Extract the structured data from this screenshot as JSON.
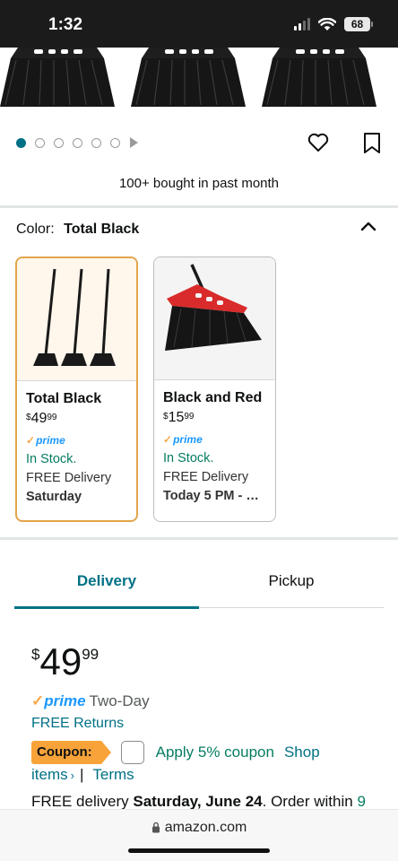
{
  "status_bar": {
    "time": "1:32",
    "battery": "68"
  },
  "carousel": {
    "dot_count": 6,
    "active_index": 0
  },
  "social_proof": "100+ bought in past month",
  "color": {
    "label": "Color:",
    "selected": "Total Black"
  },
  "swatches": [
    {
      "name": "Total Black",
      "currency": "$",
      "whole": "49",
      "cents": "99",
      "prime": "prime",
      "stock": "In Stock.",
      "delivery": "FREE Delivery",
      "day": "Saturday",
      "selected": true
    },
    {
      "name": "Black and Red",
      "currency": "$",
      "whole": "15",
      "cents": "99",
      "prime": "prime",
      "stock": "In Stock.",
      "delivery": "FREE Delivery",
      "day": "Today 5 PM - …",
      "selected": false
    }
  ],
  "tabs": [
    {
      "label": "Delivery",
      "active": true
    },
    {
      "label": "Pickup",
      "active": false
    }
  ],
  "price": {
    "currency": "$",
    "whole": "49",
    "cents": "99"
  },
  "prime_row": {
    "prime": "prime",
    "speed": "Two-Day"
  },
  "free_returns": "FREE Returns",
  "coupon": {
    "badge": "Coupon:",
    "text": "Apply 5% coupon",
    "shop": "Shop",
    "items": "items",
    "terms": "Terms"
  },
  "delivery_line": {
    "prefix": "FREE delivery ",
    "date": "Saturday, June 24",
    "middle": ". Order within ",
    "time": "9"
  },
  "url_bar": {
    "url": "amazon.com"
  },
  "colors": {
    "teal": "#007185",
    "green": "#067d62",
    "orange": "#f7a33a",
    "prime_blue": "#1a98ff",
    "selected_border": "#e3a44a"
  }
}
